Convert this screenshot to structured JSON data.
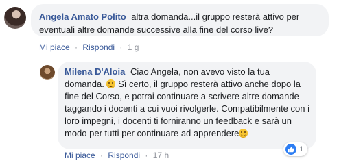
{
  "comment": {
    "author": "Angela Amato Polito",
    "text": "altra domanda...il gruppo resterà attivo per eventuali altre domande successive alla fine del corso live?",
    "actions": {
      "like": "Mi piace",
      "reply": "Rispondi",
      "time": "1 g",
      "separator": "·"
    }
  },
  "reply": {
    "author": "Milena D'Aloia",
    "text_part1": "Ciao Angela, non avevo visto la tua domanda.",
    "text_part2": "Sì certo, il gruppo resterà attivo anche dopo la fine del Corso, e potrai continuare a scrivere altre domande taggando i docenti a cui vuoi rivolgerle. Compatibilmente con i loro impegni, i docenti ti forniranno un feedback e sarà un modo per tutti per continuare ad apprendere",
    "reaction_count": "1",
    "actions": {
      "like": "Mi piace",
      "reply": "Rispondi",
      "time": "17 h",
      "separator": "·"
    }
  },
  "icons": {
    "emoji": "smiling-face-icon",
    "reaction": "like-thumb-icon"
  },
  "colors": {
    "author": "#385898",
    "bubble": "#f2f3f5",
    "like_blue": "#2e7ef3",
    "meta_gray": "#90949c"
  }
}
